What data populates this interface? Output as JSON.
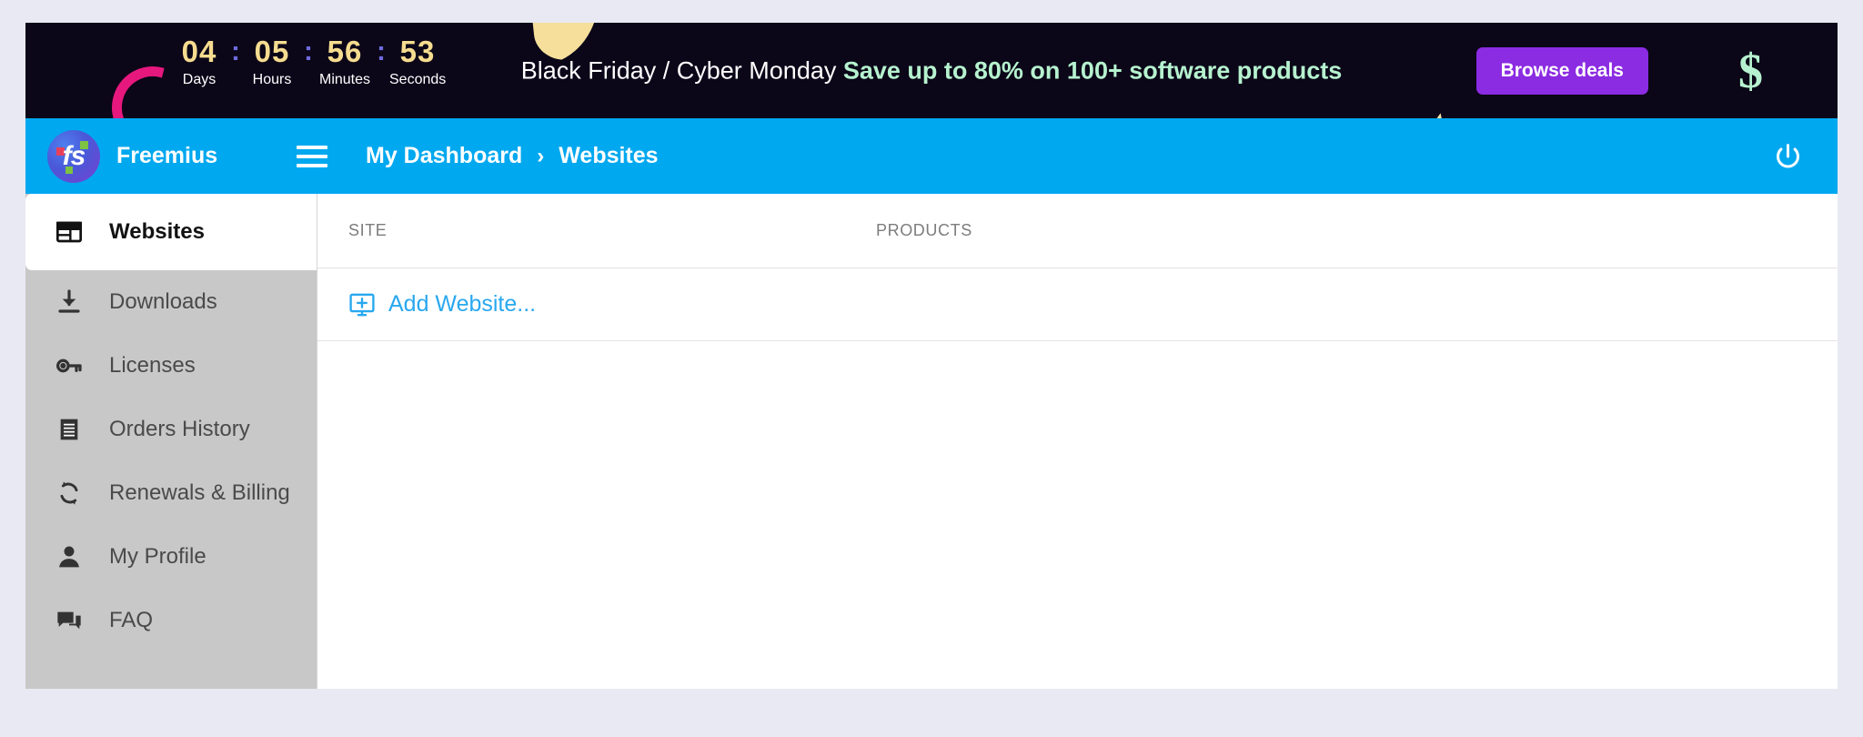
{
  "promo": {
    "countdown": [
      {
        "value": "04",
        "label": "Days"
      },
      {
        "value": "05",
        "label": "Hours"
      },
      {
        "value": "56",
        "label": "Minutes"
      },
      {
        "value": "53",
        "label": "Seconds"
      }
    ],
    "separator": ":",
    "message_plain": "Black Friday / Cyber Monday ",
    "message_highlight": "Save up to 80% on 100+ software products",
    "cta_label": "Browse deals",
    "money_icon": "dollar-sign-icon",
    "close_icon": "close-icon",
    "colors": {
      "background": "#0b0618",
      "cta": "#8b2be2",
      "highlight": "#b6f2cf",
      "number": "#f5dc8f",
      "separator": "#6d6bdd"
    }
  },
  "header": {
    "brand_name": "Freemius",
    "brand_logo": "freemius-logo",
    "menu_icon": "hamburger-menu-icon",
    "breadcrumb": {
      "parent": "My Dashboard",
      "separator": "›",
      "current": "Websites"
    },
    "logout_icon": "power-icon",
    "background": "#00a8ef"
  },
  "sidebar": {
    "items": [
      {
        "label": "Websites",
        "icon": "browser-window-icon",
        "active": true
      },
      {
        "label": "Downloads",
        "icon": "download-icon",
        "active": false
      },
      {
        "label": "Licenses",
        "icon": "key-icon",
        "active": false
      },
      {
        "label": "Orders History",
        "icon": "receipt-icon",
        "active": false
      },
      {
        "label": "Renewals & Billing",
        "icon": "sync-refresh-icon",
        "active": false
      },
      {
        "label": "My Profile",
        "icon": "person-icon",
        "active": false
      },
      {
        "label": "FAQ",
        "icon": "chat-bubble-icon",
        "active": false
      }
    ]
  },
  "main": {
    "columns": {
      "site": "SITE",
      "products": "PRODUCTS"
    },
    "rows": [],
    "add_website_label": "Add Website...",
    "add_website_icon": "monitor-plus-icon"
  }
}
